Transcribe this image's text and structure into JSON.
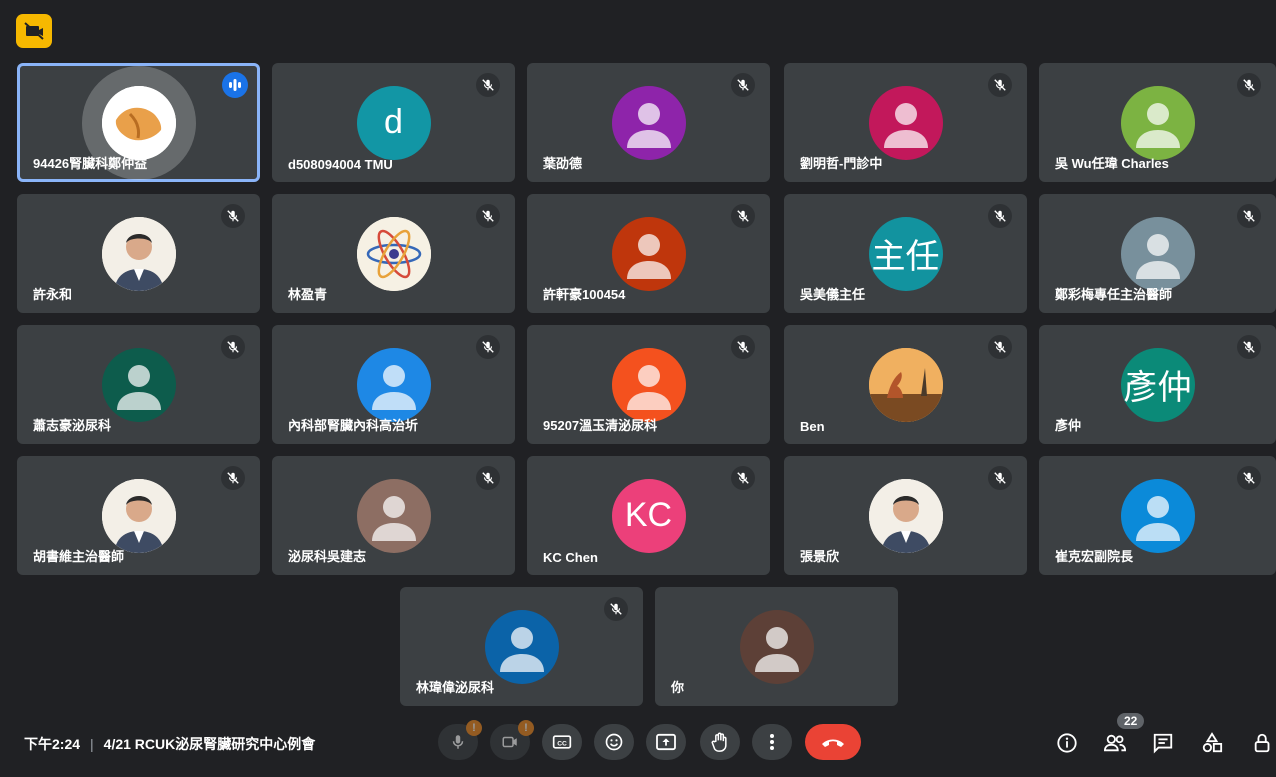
{
  "meeting": {
    "time": "下午2:24",
    "separator": "|",
    "title": "4/21 RCUK泌尿腎臟研究中心例會"
  },
  "people_count": "22",
  "participants": [
    {
      "name": "94426腎臟科鄭仲益",
      "avatar": "fortune-cookie-photo",
      "bg": "#ffffff",
      "speaking": true
    },
    {
      "name": "d508094004 TMU",
      "avatar": "letter",
      "initial": "d",
      "bg": "#1296a5"
    },
    {
      "name": "葉劭德",
      "avatar": "person",
      "bg": "#8e24aa"
    },
    {
      "name": "劉明哲-門診中",
      "avatar": "person",
      "bg": "#c2185b"
    },
    {
      "name": "吳 Wu任瑋 Charles",
      "avatar": "person",
      "bg": "#7cb342"
    },
    {
      "name": "許永和",
      "avatar": "portrait-photo",
      "bg": "#f5efe0"
    },
    {
      "name": "林盈青",
      "avatar": "atom-photo",
      "bg": "#f6f1e4"
    },
    {
      "name": "許軒豪100454",
      "avatar": "person",
      "bg": "#bf360c"
    },
    {
      "name": "吳美儀主任",
      "avatar": "letter",
      "initial": "主任",
      "bg": "#12939f"
    },
    {
      "name": "鄭彩梅專任主治醫師",
      "avatar": "person",
      "bg": "#78909c"
    },
    {
      "name": "蕭志豪泌尿科",
      "avatar": "person",
      "bg": "#0d5c4c"
    },
    {
      "name": "內科部腎臟內科高治圻",
      "avatar": "person",
      "bg": "#1e88e5"
    },
    {
      "name": "95207溫玉清泌尿科",
      "avatar": "person",
      "bg": "#f4511e"
    },
    {
      "name": "Ben",
      "avatar": "eiffel-photo",
      "bg": "#e39a4a"
    },
    {
      "name": "彥仲",
      "avatar": "letter",
      "initial": "彥仲",
      "bg": "#0b8a78"
    },
    {
      "name": "胡書維主治醫師",
      "avatar": "portrait-photo",
      "bg": "#ffffff"
    },
    {
      "name": "泌尿科吳建志",
      "avatar": "person",
      "bg": "#8d6e63"
    },
    {
      "name": "KC Chen",
      "avatar": "letter",
      "initial": "KC",
      "bg": "#ec407a"
    },
    {
      "name": "張景欣",
      "avatar": "portrait-photo",
      "bg": "#ffffff"
    },
    {
      "name": "崔克宏副院長",
      "avatar": "person",
      "bg": "#0b8ad9"
    },
    {
      "name": "林瑋偉泌尿科",
      "avatar": "person",
      "bg": "#0b63a8"
    },
    {
      "name": "你",
      "avatar": "person",
      "bg": "#5d4037",
      "self": true
    }
  ],
  "controls": {
    "mic_icon": "mic-off-icon",
    "cam_icon": "camera-off-icon",
    "captions_icon": "closed-caption-icon",
    "emoji_icon": "emoji-icon",
    "present_icon": "present-screen-icon",
    "hand_icon": "raise-hand-icon",
    "more_icon": "more-vert-icon",
    "end_icon": "end-call-icon",
    "warn_mark": "!"
  }
}
